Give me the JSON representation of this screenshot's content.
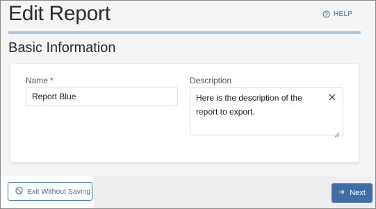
{
  "header": {
    "title": "Edit Report",
    "help_label": "HELP"
  },
  "section": {
    "title": "Basic Information"
  },
  "form": {
    "name_label": "Name",
    "name_required_mark": "*",
    "name_value": "Report Blue",
    "description_label": "Description",
    "description_value": "Here is the description of the report to export."
  },
  "footer": {
    "exit_label": "Exit Without Saving",
    "next_label": "Next"
  },
  "colors": {
    "accent": "#3f6ea8",
    "title_rule": "#b3c5dc",
    "required": "#c9302c"
  },
  "icons": {
    "help": "help-circle-icon",
    "clear": "close-icon",
    "exit": "cancel-circle-icon",
    "next": "arrow-right-icon"
  }
}
